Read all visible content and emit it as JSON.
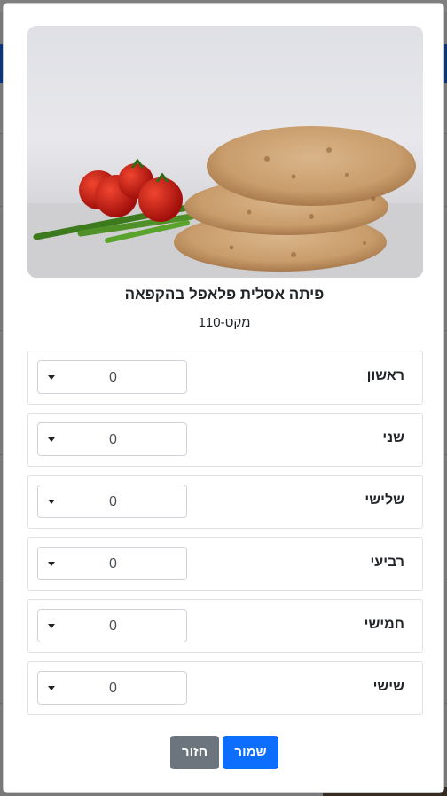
{
  "background": {
    "header_text": "…"
  },
  "product": {
    "title": "פיתה אסלית פלאפל בהקפאה",
    "sku": "מקט-110",
    "image_icon": "pita-bread-with-tomatoes-image"
  },
  "days": [
    {
      "label": "ראשון",
      "quantity": "0"
    },
    {
      "label": "שני",
      "quantity": "0"
    },
    {
      "label": "שלישי",
      "quantity": "0"
    },
    {
      "label": "רביעי",
      "quantity": "0"
    },
    {
      "label": "חמישי",
      "quantity": "0"
    },
    {
      "label": "שישי",
      "quantity": "0"
    }
  ],
  "buttons": {
    "back_label": "חזור",
    "save_label": "שמור"
  },
  "colors": {
    "primary": "#0d6efd",
    "secondary": "#6c757d"
  }
}
